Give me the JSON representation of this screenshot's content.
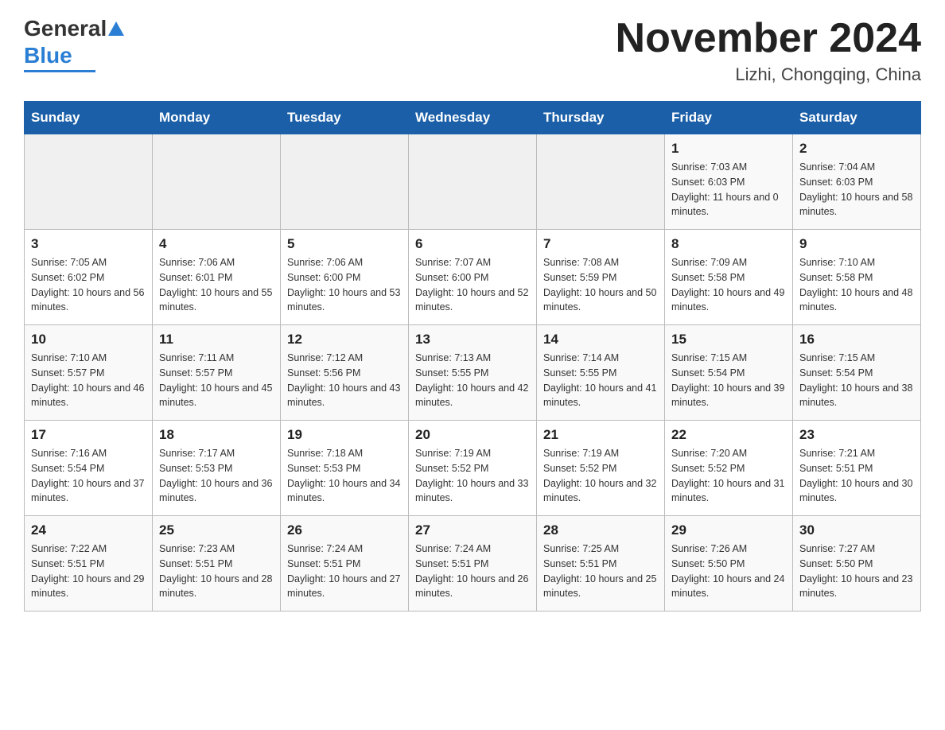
{
  "header": {
    "logo_general": "General",
    "logo_blue": "Blue",
    "title": "November 2024",
    "subtitle": "Lizhi, Chongqing, China"
  },
  "days_of_week": [
    "Sunday",
    "Monday",
    "Tuesday",
    "Wednesday",
    "Thursday",
    "Friday",
    "Saturday"
  ],
  "weeks": [
    [
      {
        "day": "",
        "info": ""
      },
      {
        "day": "",
        "info": ""
      },
      {
        "day": "",
        "info": ""
      },
      {
        "day": "",
        "info": ""
      },
      {
        "day": "",
        "info": ""
      },
      {
        "day": "1",
        "info": "Sunrise: 7:03 AM\nSunset: 6:03 PM\nDaylight: 11 hours and 0 minutes."
      },
      {
        "day": "2",
        "info": "Sunrise: 7:04 AM\nSunset: 6:03 PM\nDaylight: 10 hours and 58 minutes."
      }
    ],
    [
      {
        "day": "3",
        "info": "Sunrise: 7:05 AM\nSunset: 6:02 PM\nDaylight: 10 hours and 56 minutes."
      },
      {
        "day": "4",
        "info": "Sunrise: 7:06 AM\nSunset: 6:01 PM\nDaylight: 10 hours and 55 minutes."
      },
      {
        "day": "5",
        "info": "Sunrise: 7:06 AM\nSunset: 6:00 PM\nDaylight: 10 hours and 53 minutes."
      },
      {
        "day": "6",
        "info": "Sunrise: 7:07 AM\nSunset: 6:00 PM\nDaylight: 10 hours and 52 minutes."
      },
      {
        "day": "7",
        "info": "Sunrise: 7:08 AM\nSunset: 5:59 PM\nDaylight: 10 hours and 50 minutes."
      },
      {
        "day": "8",
        "info": "Sunrise: 7:09 AM\nSunset: 5:58 PM\nDaylight: 10 hours and 49 minutes."
      },
      {
        "day": "9",
        "info": "Sunrise: 7:10 AM\nSunset: 5:58 PM\nDaylight: 10 hours and 48 minutes."
      }
    ],
    [
      {
        "day": "10",
        "info": "Sunrise: 7:10 AM\nSunset: 5:57 PM\nDaylight: 10 hours and 46 minutes."
      },
      {
        "day": "11",
        "info": "Sunrise: 7:11 AM\nSunset: 5:57 PM\nDaylight: 10 hours and 45 minutes."
      },
      {
        "day": "12",
        "info": "Sunrise: 7:12 AM\nSunset: 5:56 PM\nDaylight: 10 hours and 43 minutes."
      },
      {
        "day": "13",
        "info": "Sunrise: 7:13 AM\nSunset: 5:55 PM\nDaylight: 10 hours and 42 minutes."
      },
      {
        "day": "14",
        "info": "Sunrise: 7:14 AM\nSunset: 5:55 PM\nDaylight: 10 hours and 41 minutes."
      },
      {
        "day": "15",
        "info": "Sunrise: 7:15 AM\nSunset: 5:54 PM\nDaylight: 10 hours and 39 minutes."
      },
      {
        "day": "16",
        "info": "Sunrise: 7:15 AM\nSunset: 5:54 PM\nDaylight: 10 hours and 38 minutes."
      }
    ],
    [
      {
        "day": "17",
        "info": "Sunrise: 7:16 AM\nSunset: 5:54 PM\nDaylight: 10 hours and 37 minutes."
      },
      {
        "day": "18",
        "info": "Sunrise: 7:17 AM\nSunset: 5:53 PM\nDaylight: 10 hours and 36 minutes."
      },
      {
        "day": "19",
        "info": "Sunrise: 7:18 AM\nSunset: 5:53 PM\nDaylight: 10 hours and 34 minutes."
      },
      {
        "day": "20",
        "info": "Sunrise: 7:19 AM\nSunset: 5:52 PM\nDaylight: 10 hours and 33 minutes."
      },
      {
        "day": "21",
        "info": "Sunrise: 7:19 AM\nSunset: 5:52 PM\nDaylight: 10 hours and 32 minutes."
      },
      {
        "day": "22",
        "info": "Sunrise: 7:20 AM\nSunset: 5:52 PM\nDaylight: 10 hours and 31 minutes."
      },
      {
        "day": "23",
        "info": "Sunrise: 7:21 AM\nSunset: 5:51 PM\nDaylight: 10 hours and 30 minutes."
      }
    ],
    [
      {
        "day": "24",
        "info": "Sunrise: 7:22 AM\nSunset: 5:51 PM\nDaylight: 10 hours and 29 minutes."
      },
      {
        "day": "25",
        "info": "Sunrise: 7:23 AM\nSunset: 5:51 PM\nDaylight: 10 hours and 28 minutes."
      },
      {
        "day": "26",
        "info": "Sunrise: 7:24 AM\nSunset: 5:51 PM\nDaylight: 10 hours and 27 minutes."
      },
      {
        "day": "27",
        "info": "Sunrise: 7:24 AM\nSunset: 5:51 PM\nDaylight: 10 hours and 26 minutes."
      },
      {
        "day": "28",
        "info": "Sunrise: 7:25 AM\nSunset: 5:51 PM\nDaylight: 10 hours and 25 minutes."
      },
      {
        "day": "29",
        "info": "Sunrise: 7:26 AM\nSunset: 5:50 PM\nDaylight: 10 hours and 24 minutes."
      },
      {
        "day": "30",
        "info": "Sunrise: 7:27 AM\nSunset: 5:50 PM\nDaylight: 10 hours and 23 minutes."
      }
    ]
  ]
}
